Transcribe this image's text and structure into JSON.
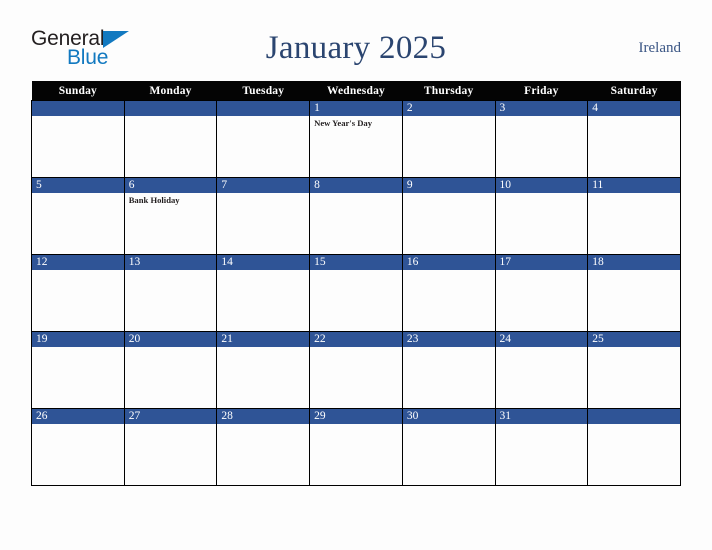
{
  "branding": {
    "logo_text_primary": "General",
    "logo_text_secondary": "Blue",
    "logo_primary_color": "#231f20",
    "logo_accent_color": "#1279c0"
  },
  "header": {
    "title": "January 2025",
    "country": "Ireland",
    "title_color": "#2b4570"
  },
  "theme": {
    "day_band_color": "#2f5496",
    "weekday_header_bg": "#040404",
    "weekday_header_text": "#ffffff",
    "cell_border_color": "#000000",
    "page_background": "#fdfdfd"
  },
  "calendar": {
    "month": "January",
    "year": "2025",
    "weekday_headers": [
      "Sunday",
      "Monday",
      "Tuesday",
      "Wednesday",
      "Thursday",
      "Friday",
      "Saturday"
    ],
    "weeks": [
      [
        {
          "num": "",
          "events": []
        },
        {
          "num": "",
          "events": []
        },
        {
          "num": "",
          "events": []
        },
        {
          "num": "1",
          "events": [
            "New Year's Day"
          ]
        },
        {
          "num": "2",
          "events": []
        },
        {
          "num": "3",
          "events": []
        },
        {
          "num": "4",
          "events": []
        }
      ],
      [
        {
          "num": "5",
          "events": []
        },
        {
          "num": "6",
          "events": [
            "Bank Holiday"
          ]
        },
        {
          "num": "7",
          "events": []
        },
        {
          "num": "8",
          "events": []
        },
        {
          "num": "9",
          "events": []
        },
        {
          "num": "10",
          "events": []
        },
        {
          "num": "11",
          "events": []
        }
      ],
      [
        {
          "num": "12",
          "events": []
        },
        {
          "num": "13",
          "events": []
        },
        {
          "num": "14",
          "events": []
        },
        {
          "num": "15",
          "events": []
        },
        {
          "num": "16",
          "events": []
        },
        {
          "num": "17",
          "events": []
        },
        {
          "num": "18",
          "events": []
        }
      ],
      [
        {
          "num": "19",
          "events": []
        },
        {
          "num": "20",
          "events": []
        },
        {
          "num": "21",
          "events": []
        },
        {
          "num": "22",
          "events": []
        },
        {
          "num": "23",
          "events": []
        },
        {
          "num": "24",
          "events": []
        },
        {
          "num": "25",
          "events": []
        }
      ],
      [
        {
          "num": "26",
          "events": []
        },
        {
          "num": "27",
          "events": []
        },
        {
          "num": "28",
          "events": []
        },
        {
          "num": "29",
          "events": []
        },
        {
          "num": "30",
          "events": []
        },
        {
          "num": "31",
          "events": []
        },
        {
          "num": "",
          "events": []
        }
      ]
    ]
  }
}
